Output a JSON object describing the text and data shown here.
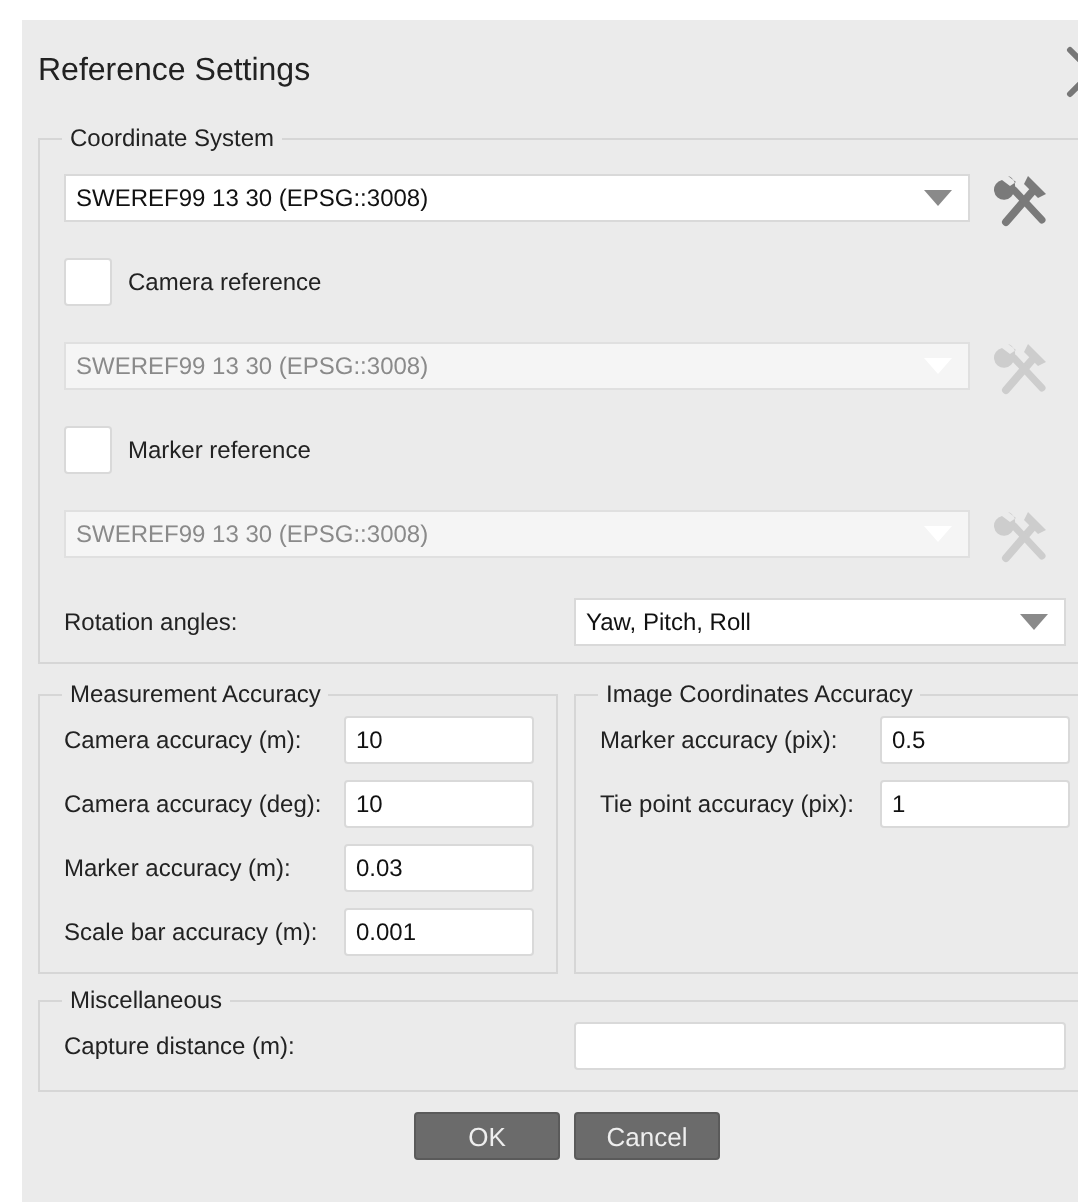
{
  "dialog": {
    "title": "Reference Settings"
  },
  "coordinate_system": {
    "title": "Coordinate System",
    "crs": {
      "value": "SWEREF99 13 30 (EPSG::3008)",
      "disabled": false
    },
    "references": [
      {
        "label": "Camera reference",
        "checked": false,
        "crs": {
          "value": "SWEREF99 13 30 (EPSG::3008)",
          "disabled": true
        }
      },
      {
        "label": "Marker reference",
        "checked": false,
        "crs": {
          "value": "SWEREF99 13 30 (EPSG::3008)",
          "disabled": true
        }
      }
    ],
    "rotation_angles": {
      "label": "Rotation angles:",
      "value": "Yaw, Pitch, Roll"
    }
  },
  "measurement_accuracy": {
    "title": "Measurement Accuracy",
    "fields": [
      {
        "label": "Camera accuracy (m):",
        "value": "10"
      },
      {
        "label": "Camera accuracy (deg):",
        "value": "10"
      },
      {
        "label": "Marker accuracy (m):",
        "value": "0.03"
      },
      {
        "label": "Scale bar accuracy (m):",
        "value": "0.001"
      }
    ]
  },
  "image_coordinates_accuracy": {
    "title": "Image Coordinates Accuracy",
    "fields": [
      {
        "label": "Marker accuracy (pix):",
        "value": "0.5"
      },
      {
        "label": "Tie point accuracy (pix):",
        "value": "1"
      }
    ]
  },
  "miscellaneous": {
    "title": "Miscellaneous",
    "fields": [
      {
        "label": "Capture distance (m):"
      }
    ]
  },
  "buttons": [
    "OK",
    "Cancel"
  ]
}
